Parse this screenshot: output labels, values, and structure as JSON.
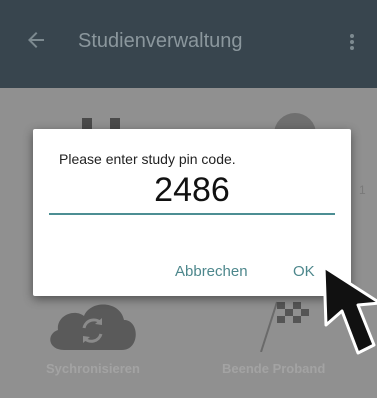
{
  "toolbar": {
    "title": "Studienverwaltung",
    "back_icon": "arrow-left-icon",
    "menu_icon": "more-vert-icon",
    "background_color": "#38454e"
  },
  "background_tiles": {
    "sync_label": "Sychronisieren",
    "sync_icon": "cloud-sync-icon",
    "end_label": "Beende Proband",
    "end_icon": "checkered-flag-icon",
    "side_value": "1"
  },
  "dialog": {
    "message": "Please enter study pin code.",
    "pin_value": "2486",
    "cancel_label": "Abbrechen",
    "ok_label": "OK",
    "accent_color": "#4c8e93"
  },
  "pointer": {
    "icon": "mouse-pointer-icon"
  }
}
